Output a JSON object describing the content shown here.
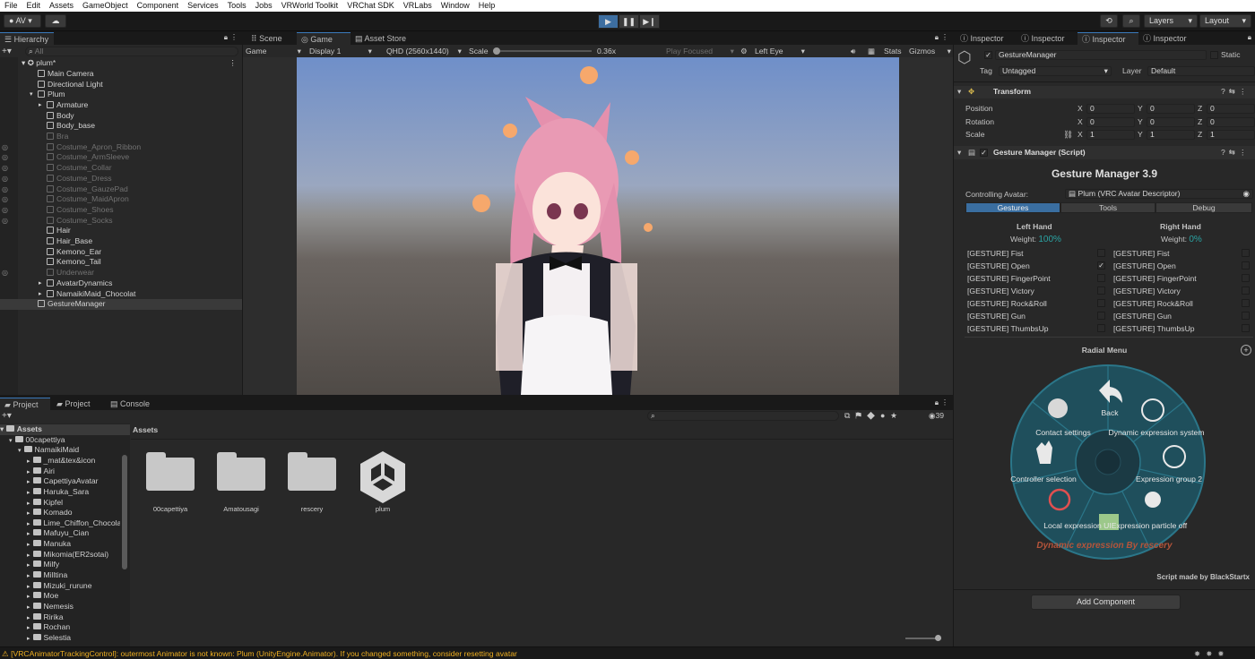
{
  "menu": [
    "File",
    "Edit",
    "Assets",
    "GameObject",
    "Component",
    "Services",
    "Tools",
    "Jobs",
    "VRWorld Toolkit",
    "VRChat SDK",
    "VRLabs",
    "Window",
    "Help"
  ],
  "toolbar": {
    "account": "AV",
    "layers": "Layers",
    "layout": "Layout"
  },
  "hierarchy": {
    "tab": "Hierarchy",
    "search_placeholder": "All",
    "scene": "plum*",
    "items": [
      {
        "label": "Main Camera",
        "disabled": false
      },
      {
        "label": "Directional Light",
        "disabled": false
      },
      {
        "label": "Plum",
        "disabled": false
      },
      {
        "label": "Armature",
        "disabled": false
      },
      {
        "label": "Body",
        "disabled": false
      },
      {
        "label": "Body_base",
        "disabled": false
      },
      {
        "label": "Bra",
        "disabled": true
      },
      {
        "label": "Costume_Apron_Ribbon",
        "disabled": true
      },
      {
        "label": "Costume_ArmSleeve",
        "disabled": true
      },
      {
        "label": "Costume_Collar",
        "disabled": true
      },
      {
        "label": "Costume_Dress",
        "disabled": true
      },
      {
        "label": "Costume_GauzePad",
        "disabled": true
      },
      {
        "label": "Costume_MaidApron",
        "disabled": true
      },
      {
        "label": "Costume_Shoes",
        "disabled": true
      },
      {
        "label": "Costume_Socks",
        "disabled": true
      },
      {
        "label": "Hair",
        "disabled": false
      },
      {
        "label": "Hair_Base",
        "disabled": false
      },
      {
        "label": "Kemono_Ear",
        "disabled": false
      },
      {
        "label": "Kemono_Tail",
        "disabled": false
      },
      {
        "label": "Underwear",
        "disabled": true
      },
      {
        "label": "AvatarDynamics",
        "disabled": false
      },
      {
        "label": "NamaikiMaid_Chocolat",
        "disabled": false
      },
      {
        "label": "GestureManager",
        "disabled": false
      }
    ]
  },
  "game": {
    "tabs": [
      "Scene",
      "Game",
      "Asset Store"
    ],
    "mode": "Game",
    "display": "Display 1",
    "resolution": "QHD (2560x1440)",
    "scale_label": "Scale",
    "scale_value": "0.36x",
    "play_focused": "Play Focused",
    "eye": "Left Eye",
    "stats": "Stats",
    "gizmos": "Gizmos"
  },
  "project": {
    "tabs": [
      "Project",
      "Project",
      "Console"
    ],
    "tree_root": "Assets",
    "tree": [
      "00capettiya",
      "NamaikiMaid",
      "_mat&tex&icon",
      "Airi",
      "CapettiyaAvatar",
      "Haruka_Sara",
      "Kipfel",
      "Komado",
      "Lime_Chiffon_Chocolat",
      "Mafuyu_Cian",
      "Manuka",
      "Mikomia(ER2sotai)",
      "Milfy",
      "Milltina",
      "Mizuki_rurune",
      "Moe",
      "Nemesis",
      "Ririka",
      "Rochan",
      "Selestia"
    ],
    "breadcrumb": "Assets",
    "hidden_count": "39",
    "assets": [
      "00capettiya",
      "Amatousagi",
      "rescery",
      "plum"
    ]
  },
  "inspector": {
    "tabs": [
      "Inspector",
      "Inspector",
      "Inspector",
      "Inspector"
    ],
    "object_name": "GestureManager",
    "static_label": "Static",
    "tag_label": "Tag",
    "tag_value": "Untagged",
    "layer_label": "Layer",
    "layer_value": "Default",
    "transform": {
      "title": "Transform",
      "rows": [
        {
          "label": "Position",
          "x": "0",
          "y": "0",
          "z": "0"
        },
        {
          "label": "Rotation",
          "x": "0",
          "y": "0",
          "z": "0"
        },
        {
          "label": "Scale",
          "x": "1",
          "y": "1",
          "z": "1"
        }
      ]
    },
    "script": {
      "title": "Gesture Manager (Script)",
      "heading": "Gesture Manager 3.9",
      "controlling_label": "Controlling Avatar:",
      "controlling_value": "Plum (VRC Avatar Descriptor)",
      "subtabs": [
        "Gestures",
        "Tools",
        "Debug"
      ],
      "left_hand": "Left Hand",
      "right_hand": "Right Hand",
      "weight_label": "Weight:",
      "left_weight": "100%",
      "right_weight": "0%",
      "gestures": [
        "[GESTURE] Fist",
        "[GESTURE] Open",
        "[GESTURE] FingerPoint",
        "[GESTURE] Victory",
        "[GESTURE] Rock&Roll",
        "[GESTURE] Gun",
        "[GESTURE] ThumbsUp"
      ],
      "left_checked_index": 1,
      "radial_title": "Radial Menu",
      "radial_items": [
        "Back",
        "Dynamic expression system",
        "Expression group 2",
        "Expression particle off",
        "Local expression UI",
        "Controller selection",
        "Contact settings"
      ],
      "radial_footer": "Dynamic expression  By rescery",
      "credit": "Script made by BlackStartx"
    },
    "add_component": "Add Component"
  },
  "status": "[VRCAnimatorTrackingControl]: outermost Animator is not known: Plum (UnityEngine.Animator). If you changed something, consider resetting avatar",
  "colors": {
    "accent": "#3a79bb",
    "selected_row": "#2c5d87",
    "weight_teal": "#2aa3a3",
    "warning": "#f0b020",
    "radial_bg": "#1f4f5c"
  }
}
